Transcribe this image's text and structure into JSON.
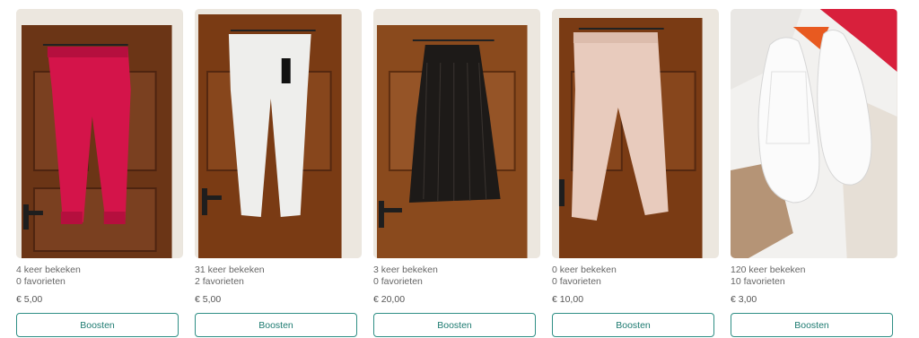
{
  "items": [
    {
      "photo": "red-sweatpants-on-door-photo",
      "views": "4 keer bekeken",
      "favorites": "0 favorieten",
      "price": "€ 5,00",
      "button": "Boosten"
    },
    {
      "photo": "white-trousers-on-door-photo",
      "views": "31 keer bekeken",
      "favorites": "2 favorieten",
      "price": "€ 5,00",
      "button": "Boosten"
    },
    {
      "photo": "black-pleated-skirt-on-door-photo",
      "views": "3 keer bekeken",
      "favorites": "0 favorieten",
      "price": "€ 20,00",
      "button": "Boosten"
    },
    {
      "photo": "pink-trousers-on-door-photo",
      "views": "0 keer bekeken",
      "favorites": "0 favorieten",
      "price": "€ 10,00",
      "button": "Boosten"
    },
    {
      "photo": "white-knit-shoes-photo",
      "views": "120 keer bekeken",
      "favorites": "10 favorieten",
      "price": "€ 3,00",
      "button": "Boosten"
    }
  ],
  "colors": {
    "accent": "#1c7a70",
    "door": "#6b3516",
    "wall": "#ece7df"
  }
}
